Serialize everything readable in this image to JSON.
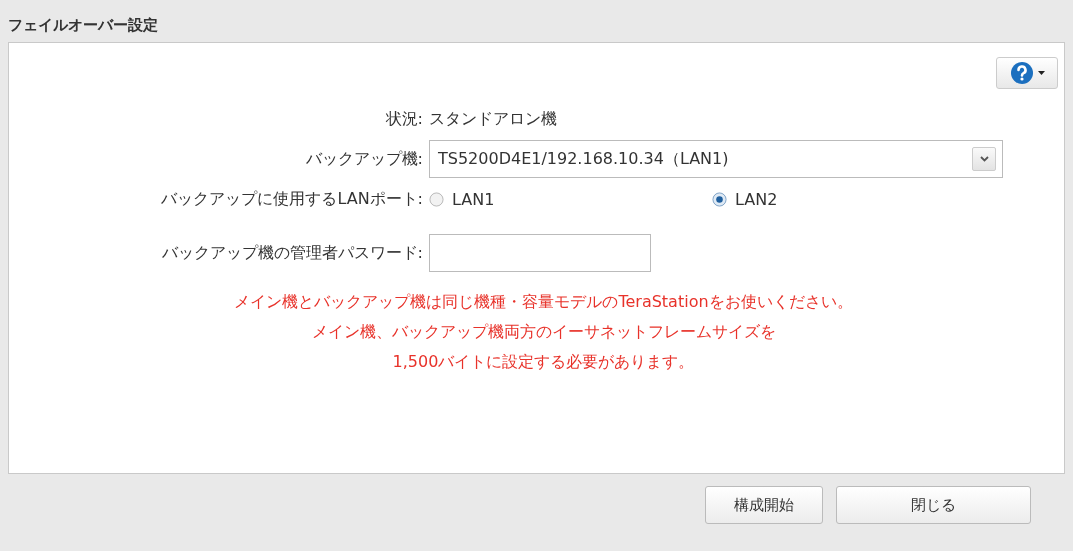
{
  "window": {
    "title": "フェイルオーバー設定"
  },
  "status": {
    "label": "状況:",
    "value": "スタンドアロン機"
  },
  "backup_unit": {
    "label": "バックアップ機:",
    "value": "TS5200D4E1/192.168.10.34（LAN1)"
  },
  "lan_port": {
    "label": "バックアップに使用するLANポート:",
    "options": [
      {
        "label": "LAN1",
        "selected": false
      },
      {
        "label": "LAN2",
        "selected": true
      }
    ]
  },
  "password": {
    "label": "バックアップ機の管理者パスワード:"
  },
  "notes": [
    "メイン機とバックアップ機は同じ機種・容量モデルのTeraStationをお使いください。",
    "メイン機、バックアップ機両方のイーサネットフレームサイズを",
    "1,500バイトに設定する必要があります。"
  ],
  "buttons": [
    "構成開始",
    "閉じる"
  ]
}
